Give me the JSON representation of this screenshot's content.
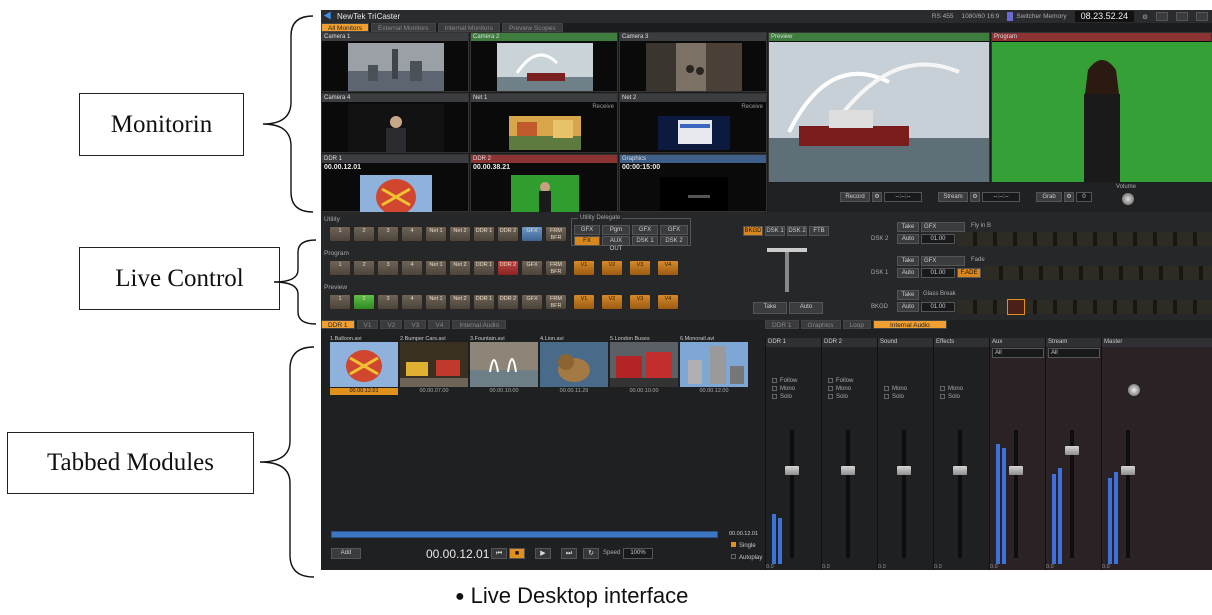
{
  "annotations": {
    "monitoring": "Monitorin",
    "live_control": "Live Control",
    "tabbed_modules": "Tabbed Modules",
    "caption": "Live Desktop interface"
  },
  "app": {
    "title": "NewTek TriCaster",
    "status": {
      "rs": "RS 455",
      "format": "1080/60 16:9",
      "switcher_memory": "Switcher Memory",
      "clock": "08.23.52.24"
    },
    "monitor_tabs": [
      "All Monitors",
      "External Monitors",
      "Internal Monitors",
      "Preview Scopes"
    ],
    "monitors": [
      {
        "label": "Camera 1"
      },
      {
        "label": "Camera 2"
      },
      {
        "label": "Camera 3"
      },
      {
        "label": "Camera 4"
      },
      {
        "label": "Net 1",
        "receive": "Receive"
      },
      {
        "label": "Net 2",
        "receive": "Receive"
      },
      {
        "label": "DDR 1",
        "time": "00.00.12.01"
      },
      {
        "label": "DDR 2",
        "time": "00.00.38.21"
      },
      {
        "label": "Graphics",
        "time": "00:00:15:00"
      }
    ],
    "preview_label": "Preview",
    "program_label": "Program",
    "output_controls": {
      "record": "Record",
      "stream": "Stream",
      "grab": "Grab",
      "grab_count": "0",
      "volume": "Volume",
      "timer": "--:--:--"
    }
  },
  "live_control": {
    "rows": {
      "utility": "Utility",
      "program": "Program",
      "preview": "Preview"
    },
    "sources": [
      "1",
      "2",
      "3",
      "4",
      "Net 1",
      "Net 2",
      "DDR 1",
      "DDR 2",
      "GFX",
      "FRM BFR"
    ],
    "utility_delegate": {
      "title": "Utility Delegate",
      "top": [
        "GFX",
        "Pgm",
        "GFX",
        "GFX"
      ],
      "bottom": [
        "FX",
        "AUX OUT",
        "DSK 1",
        "DSK 2"
      ]
    },
    "virtual_inputs": [
      "V1",
      "V2",
      "V3",
      "V4"
    ],
    "transition_tabs": [
      "BKGD",
      "DSK 1",
      "DSK 2",
      "FTB"
    ],
    "take": "Take",
    "auto": "Auto",
    "dsk_rows": [
      {
        "label": "DSK 2",
        "source": "GFX",
        "effect": "Fly in B",
        "speed": "01.00"
      },
      {
        "label": "DSK 1",
        "source": "GFX",
        "effect": "Fade",
        "speed": "01.00",
        "tag": "F.ADE"
      },
      {
        "label": "BKGD",
        "source": "",
        "effect": "Glass Break",
        "speed": "01.00"
      }
    ]
  },
  "modules": {
    "tabs": [
      "DDR 1",
      "V1",
      "V2",
      "V3",
      "V4",
      "Internal Audio"
    ],
    "clips": [
      {
        "name": "1.Balloon.avi",
        "tc": "00.00.12.01"
      },
      {
        "name": "2.Bumper Cars.avi",
        "tc": "00.00.07.00"
      },
      {
        "name": "3.Fountain.avi",
        "tc": "00.00.10.00"
      },
      {
        "name": "4.Lion.avi",
        "tc": "00.00.11.29"
      },
      {
        "name": "5.London Buses",
        "tc": "00.00.10.00"
      },
      {
        "name": "6.Monorail.avi",
        "tc": "00.00.12.00"
      }
    ],
    "scrub_end": "00.00.12.01",
    "add": "Add",
    "timecode": "00.00.12.01",
    "speed_label": "Speed",
    "speed_value": "100%",
    "single": "Single",
    "autoplay": "Autoplay",
    "audio_tabs": [
      "DDR 1",
      "Graphics",
      "Loop",
      "Internal Audio"
    ],
    "audio_strips": [
      {
        "name": "DDR 1",
        "follow": "Follow",
        "mono": "Mono",
        "solo": "Solo",
        "level": "0.0"
      },
      {
        "name": "DDR 2",
        "follow": "Follow",
        "mono": "Mono",
        "solo": "Solo",
        "level": "0.0"
      },
      {
        "name": "Sound",
        "mono": "Mono",
        "solo": "Solo",
        "level": "0.0"
      },
      {
        "name": "Effects",
        "mono": "Mono",
        "solo": "Solo",
        "level": "0.0"
      },
      {
        "name": "Aux",
        "select": "All",
        "level": "0.0"
      },
      {
        "name": "Stream",
        "select": "All",
        "level": "0.0"
      },
      {
        "name": "Master",
        "level": "0.0"
      }
    ]
  },
  "colors": {
    "accent": "#e0911c",
    "meter": "#3e72d8",
    "preview_tally": "#3f7d3f",
    "program_tally": "#8c3434"
  }
}
